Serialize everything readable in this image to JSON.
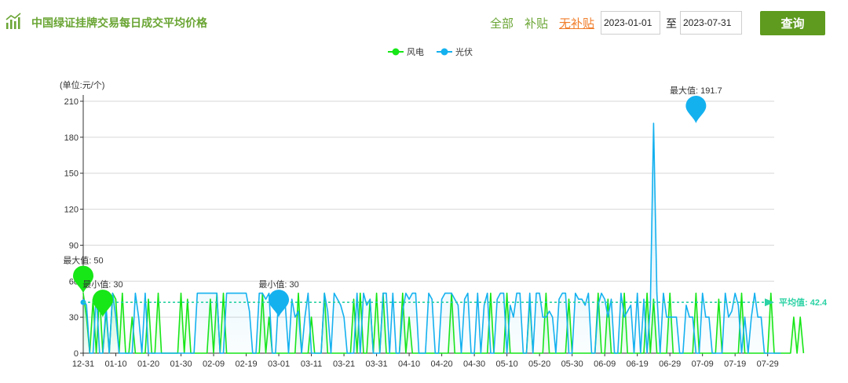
{
  "header": {
    "title": "中国绿证挂牌交易每日成交平均价格",
    "filters": [
      "全部",
      "补贴",
      "无补贴"
    ],
    "active_filter": "无补贴",
    "start_date": "2023-01-01",
    "to_label": "至",
    "end_date": "2023-07-31",
    "query_label": "查询"
  },
  "colors": {
    "accent": "#6aa534",
    "active_filter": "#f07d2a",
    "button": "#5e9b1e",
    "wind": "#17e617",
    "solar": "#14b1ef",
    "average": "#2bd2a4"
  },
  "chart_data": {
    "type": "line",
    "unit_label": "(单位:元/个)",
    "ylim": [
      0,
      210
    ],
    "yticks": [
      0,
      30,
      60,
      90,
      120,
      150,
      180,
      210
    ],
    "x_tick_labels": [
      "12-31",
      "01-10",
      "01-20",
      "01-30",
      "02-09",
      "02-19",
      "03-01",
      "03-11",
      "03-21",
      "03-31",
      "04-10",
      "04-20",
      "04-30",
      "05-10",
      "05-20",
      "05-30",
      "06-09",
      "06-19",
      "06-29",
      "07-09",
      "07-19",
      "07-29"
    ],
    "x_start": "2022-12-31",
    "x_end": "2023-07-31",
    "grid": true,
    "legend_position": "top-center",
    "series": [
      {
        "name": "风电",
        "color": "#17e617",
        "values": [
          50,
          30,
          0,
          45,
          0,
          50,
          0,
          35,
          0,
          50,
          45,
          0,
          50,
          0,
          0,
          30,
          0,
          0,
          0,
          0,
          45,
          0,
          0,
          50,
          0,
          0,
          0,
          0,
          0,
          0,
          50,
          0,
          45,
          0,
          0,
          0,
          0,
          0,
          0,
          45,
          0,
          50,
          0,
          50,
          0,
          0,
          0,
          0,
          0,
          0,
          0,
          0,
          0,
          0,
          0,
          50,
          0,
          30,
          0,
          0,
          0,
          0,
          0,
          0,
          0,
          0,
          50,
          0,
          0,
          0,
          30,
          0,
          0,
          0,
          50,
          0,
          0,
          0,
          0,
          0,
          0,
          0,
          0,
          45,
          0,
          50,
          0,
          0,
          45,
          0,
          50,
          0,
          50,
          0,
          0,
          0,
          0,
          0,
          50,
          0,
          30,
          0,
          0,
          0,
          0,
          0,
          0,
          0,
          0,
          0,
          0,
          0,
          0,
          50,
          0,
          0,
          0,
          0,
          0,
          0,
          0,
          0,
          0,
          0,
          0,
          50,
          0,
          0,
          0,
          0,
          50,
          0,
          0,
          0,
          0,
          0,
          0,
          45,
          0,
          0,
          0,
          0,
          50,
          0,
          0,
          0,
          0,
          0,
          0,
          45,
          0,
          0,
          0,
          0,
          0,
          0,
          0,
          0,
          50,
          0,
          0,
          45,
          0,
          0,
          0,
          0,
          50,
          0,
          0,
          0,
          0,
          0,
          0,
          50,
          0,
          45,
          0,
          0,
          0,
          0,
          50,
          0,
          0,
          0,
          0,
          0,
          0,
          0,
          50,
          0,
          0,
          0,
          0,
          0,
          0,
          45,
          0,
          0,
          0,
          0,
          0,
          0,
          50,
          0,
          0,
          0,
          0,
          0,
          0,
          0,
          0,
          50,
          0,
          0,
          0,
          0,
          0,
          0,
          30,
          0,
          30,
          0
        ]
      },
      {
        "name": "光伏",
        "color": "#14b1ef",
        "values": [
          45,
          40,
          0,
          0,
          50,
          0,
          0,
          40,
          0,
          50,
          30,
          0,
          0,
          0,
          0,
          0,
          50,
          30,
          0,
          50,
          0,
          0,
          0,
          0,
          0,
          0,
          0,
          0,
          0,
          0,
          0,
          0,
          0,
          0,
          0,
          50,
          50,
          50,
          50,
          50,
          50,
          50,
          0,
          0,
          50,
          50,
          50,
          50,
          50,
          50,
          50,
          35,
          0,
          0,
          50,
          50,
          45,
          50,
          0,
          0,
          50,
          50,
          40,
          0,
          45,
          30,
          35,
          0,
          30,
          50,
          0,
          0,
          0,
          0,
          50,
          35,
          0,
          50,
          45,
          40,
          30,
          0,
          0,
          0,
          50,
          0,
          50,
          40,
          45,
          0,
          0,
          0,
          50,
          50,
          0,
          50,
          0,
          0,
          35,
          50,
          45,
          50,
          50,
          0,
          0,
          0,
          50,
          45,
          0,
          0,
          45,
          50,
          50,
          50,
          45,
          40,
          0,
          45,
          50,
          0,
          0,
          50,
          0,
          40,
          50,
          0,
          0,
          45,
          50,
          50,
          0,
          40,
          30,
          50,
          50,
          0,
          0,
          50,
          0,
          50,
          50,
          30,
          30,
          35,
          30,
          0,
          45,
          50,
          50,
          0,
          0,
          50,
          45,
          45,
          40,
          50,
          0,
          0,
          40,
          50,
          45,
          30,
          45,
          0,
          0,
          50,
          30,
          35,
          40,
          0,
          50,
          0,
          45,
          0,
          40,
          191.7,
          50,
          0,
          50,
          30,
          30,
          30,
          30,
          0,
          0,
          40,
          30,
          30,
          0,
          0,
          50,
          30,
          30,
          0,
          0,
          0,
          0,
          50,
          30,
          35,
          50,
          40,
          0,
          30,
          0,
          30,
          50,
          30,
          30,
          0,
          0,
          0,
          0,
          0,
          0
        ]
      }
    ],
    "average_label": "平均值: 42.4",
    "average_value": 42.4,
    "annotations": [
      {
        "series": "风电",
        "label": "最大值: 50",
        "value": 50,
        "x": "2022-12-31"
      },
      {
        "series": "风电",
        "label": "最小值: 30",
        "value": 30,
        "x": "2023-01-06"
      },
      {
        "series": "光伏",
        "label": "最小值: 30",
        "value": 30,
        "x": "2023-03-01"
      },
      {
        "series": "光伏",
        "label": "最大值: 191.7",
        "value": 191.7,
        "x": "2023-07-07"
      }
    ]
  }
}
